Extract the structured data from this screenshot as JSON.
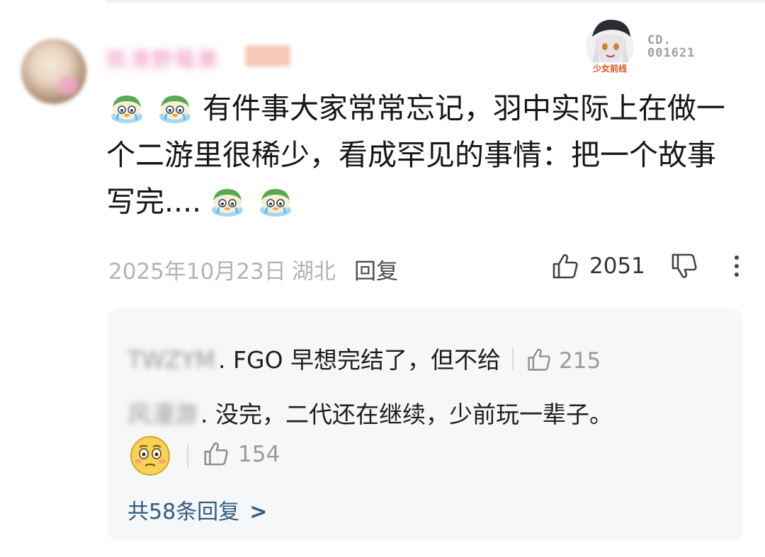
{
  "comment": {
    "username": "陈港野莓果",
    "user_tag": "徽章",
    "badge_code_line1": "CD.",
    "badge_code_line2": "001621",
    "badge_caption": "少女前线",
    "text_main": "有件事大家常常忘记，羽中实际上在做一个二游里很稀少，看成罕见的事情：把一个故事写完....",
    "emoji_name": "crying-duck-emoji",
    "date": "2025年10月23日",
    "location": "湖北",
    "reply_label": "回复",
    "like_count": "2051"
  },
  "replies": [
    {
      "author": "TWZYM",
      "text": ". FGO 早想完结了，但不给",
      "likes": "215"
    },
    {
      "author": "风漫游",
      "text": ". 没完，二代还在继续，少前玩一辈子。",
      "likes": ""
    }
  ],
  "emoji_reply": {
    "emoji_name": "blushing-face-emoji",
    "likes": "154"
  },
  "more_replies_label": "共58条回复",
  "colors": {
    "accent_link": "#2f5d82",
    "reply_bg": "#f6f7f8",
    "meta_gray": "#b4b4b4"
  }
}
